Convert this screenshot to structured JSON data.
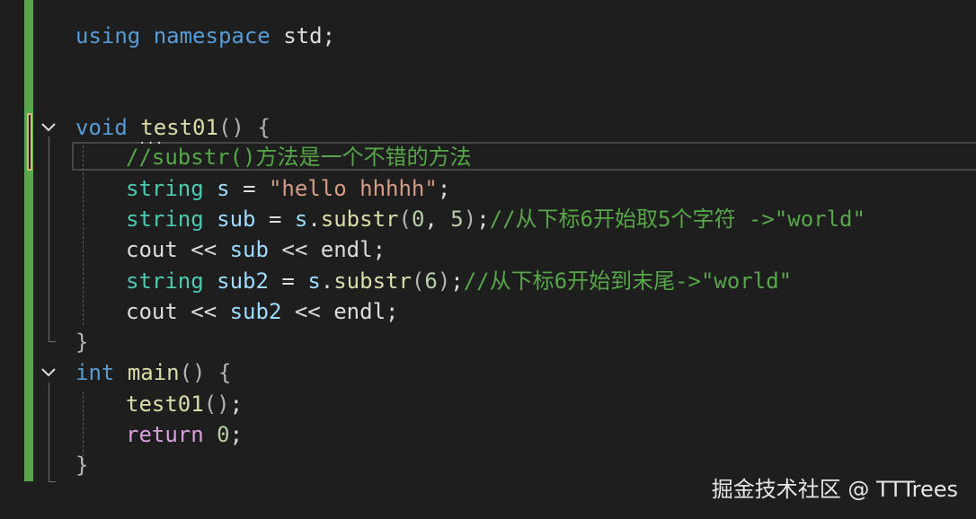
{
  "colors": {
    "background": "#1e1e1e",
    "change_bar": "#57a64a",
    "keyword": "#569cd6",
    "type": "#4ec9b0",
    "function": "#dcdcaa",
    "identifier": "#9cdcfe",
    "string": "#d69d85",
    "comment": "#57a64a",
    "control": "#d8a0df",
    "plain": "#dcdcdc"
  },
  "code": {
    "line1": {
      "kw_using": "using",
      "kw_namespace": "namespace",
      "ns": "std",
      "semi": ";"
    },
    "test01_decl": {
      "kw_void": "void",
      "name": "test01",
      "parens": "()",
      "brace": "{"
    },
    "comment1": "//substr()方法是一个不错的方法",
    "line_s": {
      "type": "string",
      "var": "s",
      "eq": "=",
      "lit": "\"hello hhhhh\"",
      "semi": ";"
    },
    "line_sub": {
      "type": "string",
      "var": "sub",
      "eq": "=",
      "obj": "s",
      "dot": ".",
      "method": "substr",
      "open": "(",
      "arg1": "0",
      "comma": ",",
      "arg2": "5",
      "close": ")",
      "semi": ";",
      "comment": "//从下标6开始取5个字符 ->\"world\""
    },
    "line_cout1": {
      "cout": "cout",
      "op1": "<<",
      "var": "sub",
      "op2": "<<",
      "endl": "endl",
      "semi": ";"
    },
    "line_sub2": {
      "type": "string",
      "var": "sub2",
      "eq": "=",
      "obj": "s",
      "dot": ".",
      "method": "substr",
      "open": "(",
      "arg1": "6",
      "close": ")",
      "semi": ";",
      "comment": "//从下标6开始到末尾->\"world\""
    },
    "line_cout2": {
      "cout": "cout",
      "op1": "<<",
      "var": "sub2",
      "op2": "<<",
      "endl": "endl",
      "semi": ";"
    },
    "close1": "}",
    "main_decl": {
      "kw_int": "int",
      "name": "main",
      "parens": "()",
      "brace": "{"
    },
    "call_test01": {
      "name": "test01",
      "parens": "()",
      "semi": ";"
    },
    "line_return": {
      "kw": "return",
      "val": "0",
      "semi": ";"
    },
    "close2": "}",
    "squiggle": "..."
  },
  "watermark": "掘金技术社区 @ TTTrees",
  "icons": {
    "fold_test01": "chevron-down-icon",
    "fold_main": "chevron-down-icon"
  }
}
